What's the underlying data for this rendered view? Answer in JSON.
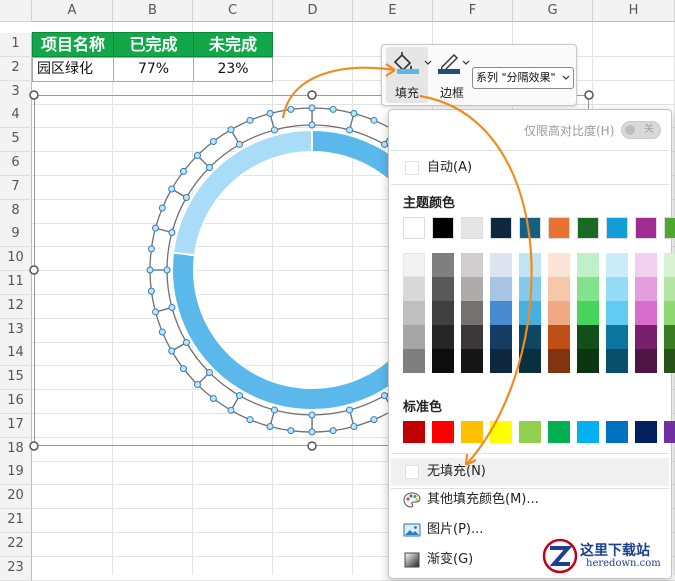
{
  "columns": [
    "A",
    "B",
    "C",
    "D",
    "E",
    "F",
    "G",
    "H"
  ],
  "rows": [
    "1",
    "2",
    "3",
    "4",
    "5",
    "6",
    "7",
    "8",
    "9",
    "10",
    "11",
    "12",
    "13",
    "14",
    "15",
    "16",
    "17",
    "18",
    "19",
    "20",
    "21",
    "22",
    "23"
  ],
  "table": {
    "headers": [
      "项目名称",
      "已完成",
      "未完成"
    ],
    "row": [
      "园区绿化",
      "77%",
      "23%"
    ]
  },
  "chart_data": {
    "type": "doughnut",
    "series": [
      {
        "name": "已完成",
        "value": 0.77,
        "color": "#5bb8ea"
      },
      {
        "name": "未完成",
        "value": 0.23,
        "color": "#a9dcf6"
      }
    ],
    "outer_ring_segments": 24
  },
  "toolbar": {
    "fill_label": "填充",
    "border_label": "边框",
    "series_select": "系列 \"分隔效果\""
  },
  "fill_panel": {
    "high_contrast_label": "仅限高对比度(H)",
    "toggle_text": "关",
    "auto_label": "自动(A)",
    "theme_title": "主题颜色",
    "standard_title": "标准色",
    "no_fill_label": "无填充(N)",
    "more_colors_label": "其他填充颜色(M)...",
    "picture_label": "图片(P)...",
    "gradient_label": "渐变(G)"
  },
  "theme_colors": [
    "#ffffff",
    "#000000",
    "#e7e6e6",
    "#0e2841",
    "#156082",
    "#e97132",
    "#196b24",
    "#0f9ed5",
    "#a02b93",
    "#4ea72e"
  ],
  "theme_shades": [
    [
      "#f2f2f2",
      "#7f7f7f",
      "#d0cece",
      "#dbe4f0",
      "#c1e4f5",
      "#fbe3d6",
      "#c1f0c8",
      "#caedfb",
      "#f2cfee",
      "#d9f2d0"
    ],
    [
      "#d9d9d9",
      "#595959",
      "#afabab",
      "#a6c5e4",
      "#83cbeb",
      "#f7c7ac",
      "#83e28e",
      "#95dcf7",
      "#e59edd",
      "#b4e5a2"
    ],
    [
      "#bfbfbf",
      "#404040",
      "#767171",
      "#4a8ad0",
      "#45b0e1",
      "#f1a983",
      "#47d45a",
      "#61cbf4",
      "#d86dcd",
      "#8ed973"
    ],
    [
      "#a6a6a6",
      "#262626",
      "#3a3838",
      "#153c63",
      "#0f4761",
      "#c04f15",
      "#124f1a",
      "#0b76a0",
      "#782069",
      "#3b7d23"
    ],
    [
      "#7f7f7f",
      "#0d0d0d",
      "#171616",
      "#0e2841",
      "#0a2f40",
      "#803410",
      "#0c3511",
      "#074f6a",
      "#501546",
      "#275317"
    ]
  ],
  "standard_colors": [
    "#c00000",
    "#ff0000",
    "#ffc000",
    "#ffff00",
    "#92d050",
    "#00b050",
    "#00b0f0",
    "#0070c0",
    "#002060",
    "#7030a0"
  ],
  "watermark": {
    "text": "这里下载站",
    "domain": "heredown.com",
    "accent": "#c5001a"
  }
}
